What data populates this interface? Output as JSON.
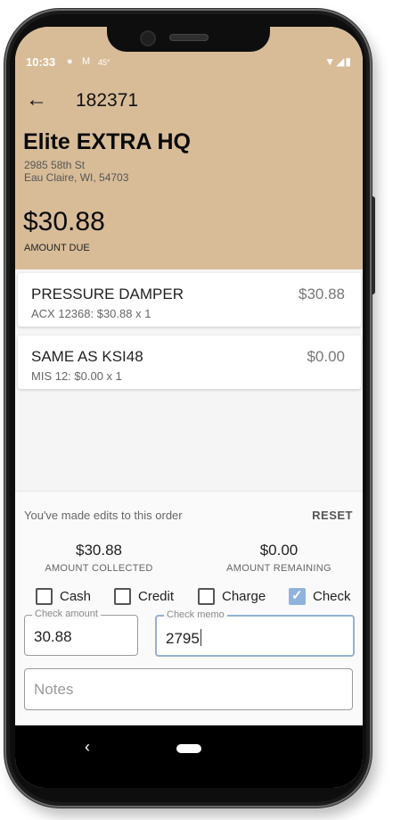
{
  "status_bar": {
    "time": "10:33",
    "icons_left": [
      "messenger-icon",
      "gmail-icon"
    ],
    "temperature": "45°",
    "icons_right": [
      "wifi-icon",
      "signal-icon",
      "battery-icon"
    ]
  },
  "header": {
    "order_number": "182371",
    "store_name": "Elite EXTRA HQ",
    "address_line1": "2985 58th St",
    "address_line2": "Eau Claire, WI, 54703",
    "amount_due": "$30.88",
    "amount_due_label": "AMOUNT DUE",
    "background_color": "#d8bc98"
  },
  "line_items": [
    {
      "name": "PRESSURE DAMPER",
      "detail": "ACX 12368: $30.88 x 1",
      "price": "$30.88"
    },
    {
      "name": "SAME AS KSI48",
      "detail": "MIS 12: $0.00 x 1",
      "price": "$0.00"
    }
  ],
  "payment": {
    "edits_message": "You've made edits to this order",
    "reset_label": "RESET",
    "amount_collected": "$30.88",
    "amount_collected_label": "AMOUNT COLLECTED",
    "amount_remaining": "$0.00",
    "amount_remaining_label": "AMOUNT REMAINING",
    "methods": [
      {
        "label": "Cash",
        "checked": false
      },
      {
        "label": "Credit",
        "checked": false
      },
      {
        "label": "Charge",
        "checked": false
      },
      {
        "label": "Check",
        "checked": true
      }
    ],
    "check_amount_label": "Check amount",
    "check_amount_value": "30.88",
    "check_memo_label": "Check memo",
    "check_memo_value": "2795",
    "notes_placeholder": "Notes"
  }
}
